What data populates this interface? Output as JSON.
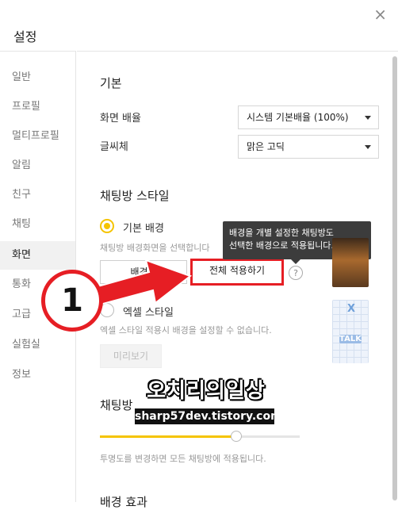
{
  "window": {
    "title": "설정",
    "close": "×"
  },
  "sidebar": {
    "items": [
      {
        "label": "일반"
      },
      {
        "label": "프로필"
      },
      {
        "label": "멀티프로필"
      },
      {
        "label": "알림"
      },
      {
        "label": "친구"
      },
      {
        "label": "채팅"
      },
      {
        "label": "화면"
      },
      {
        "label": "통화"
      },
      {
        "label": "고급"
      },
      {
        "label": "실험실"
      },
      {
        "label": "정보"
      }
    ],
    "active": "화면"
  },
  "basic": {
    "title": "기본",
    "scale_label": "화면 배율",
    "scale_value": "시스템 기본배율 (100%)",
    "font_label": "글씨체",
    "font_value": "맑은 고딕"
  },
  "chat_style": {
    "title": "채팅방 스타일",
    "default_bg_label": "기본 배경",
    "default_bg_hint": "채팅방 배경화면을 선택합니다",
    "bg_button": "배경화",
    "apply_all_button": "전체 적용하기",
    "help": "?",
    "tooltip": "배경을 개별 설정한 채팅방도\n선택한 배경으로 적용됩니다.",
    "excel_label": "엑셀 스타일",
    "excel_hint": "엑셀 스타일 적용시 배경을 설정할 수 없습니다.",
    "preview_button": "미리보기",
    "thumb_talk_x": "X",
    "thumb_talk_text": "TALK"
  },
  "transparency": {
    "title": "채팅방",
    "hint": "투명도를 변경하면 모든 채팅방에 적용됩니다.",
    "level": 0.68
  },
  "bg_effect": {
    "title": "배경 효과"
  },
  "annotation": {
    "number": "1",
    "accent": "#e61e24"
  },
  "watermark": {
    "line1": "오치리의일상",
    "line2": "sharp57dev.tistory.com"
  },
  "colors": {
    "accent": "#f5c400",
    "highlight": "#e61e24"
  }
}
